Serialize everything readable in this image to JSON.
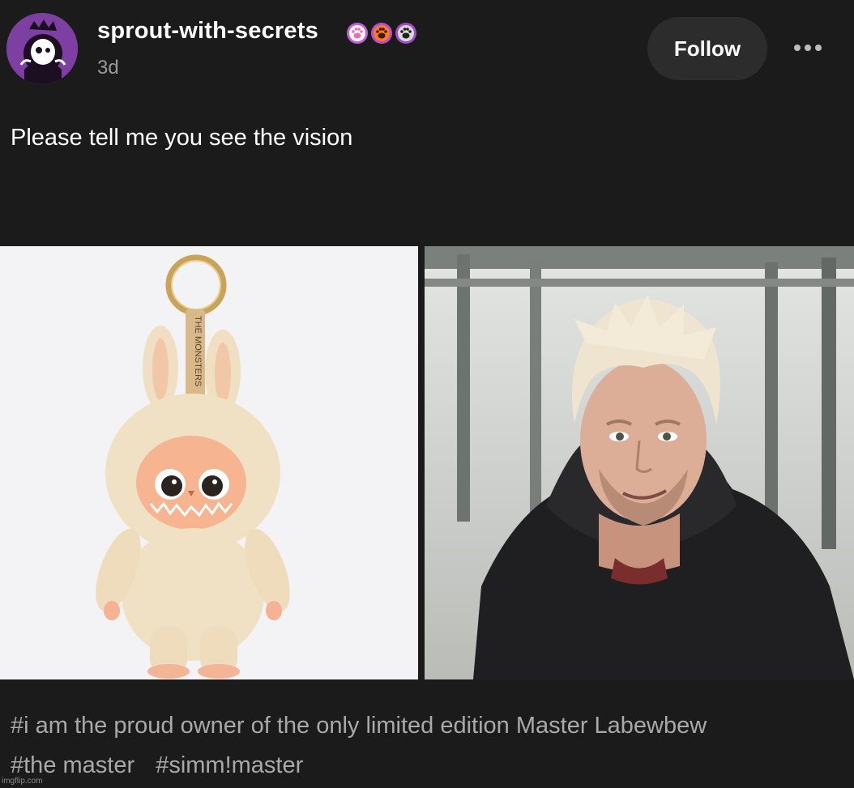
{
  "post": {
    "blog_name": "sprout-with-secrets",
    "time_ago": "3d",
    "follow_label": "Follow",
    "body_text": "Please tell me you see the vision",
    "images": {
      "left_strap_text": "THE MONSTERS"
    },
    "tags": [
      "#i am the proud owner of the only limited edition Master Labewbew",
      "#the master",
      "#simm!master"
    ]
  },
  "watermark": "imgflip.com",
  "colors": {
    "background": "#1b1b1b",
    "follow_button_bg": "#2c2c2c",
    "tag_text": "#a9a9a9",
    "timestamp_text": "#9a9a9a",
    "avatar_bg": "#7d3fa1"
  },
  "icons": [
    "avatar-mascot-icon",
    "paw-badge-icon",
    "more-options-icon"
  ]
}
